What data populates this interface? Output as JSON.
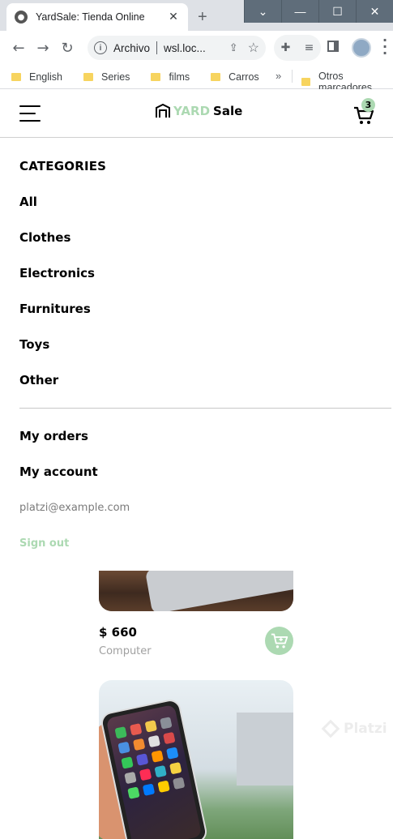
{
  "browser": {
    "tab_title": "YardSale: Tienda Online",
    "tab_close": "✕",
    "new_tab": "+",
    "window_controls": [
      "⌄",
      "—",
      "☐",
      "✕"
    ],
    "address_info": "i",
    "address_label": "Archivo",
    "address_url": "wsl.loc...",
    "bookmarks": [
      "English",
      "Series",
      "films",
      "Carros"
    ],
    "bookmarks_more": "»",
    "bookmarks_other": "Otros marcadores"
  },
  "navbar": {
    "logo_yard": "YARD",
    "logo_sale": "Sale",
    "cart_count": "3"
  },
  "menu": {
    "heading": "CATEGORIES",
    "categories": [
      "All",
      "Clothes",
      "Electronics",
      "Furnitures",
      "Toys",
      "Other"
    ],
    "my_orders": "My orders",
    "my_account": "My account",
    "email": "platzi@example.com",
    "sign_out": "Sign out"
  },
  "products": [
    {
      "price": "$ 660",
      "name": "Computer"
    }
  ],
  "watermark": "Platzi",
  "colors": {
    "accent": "#acd9b2",
    "text": "#000000",
    "muted": "#7b7b7b"
  }
}
